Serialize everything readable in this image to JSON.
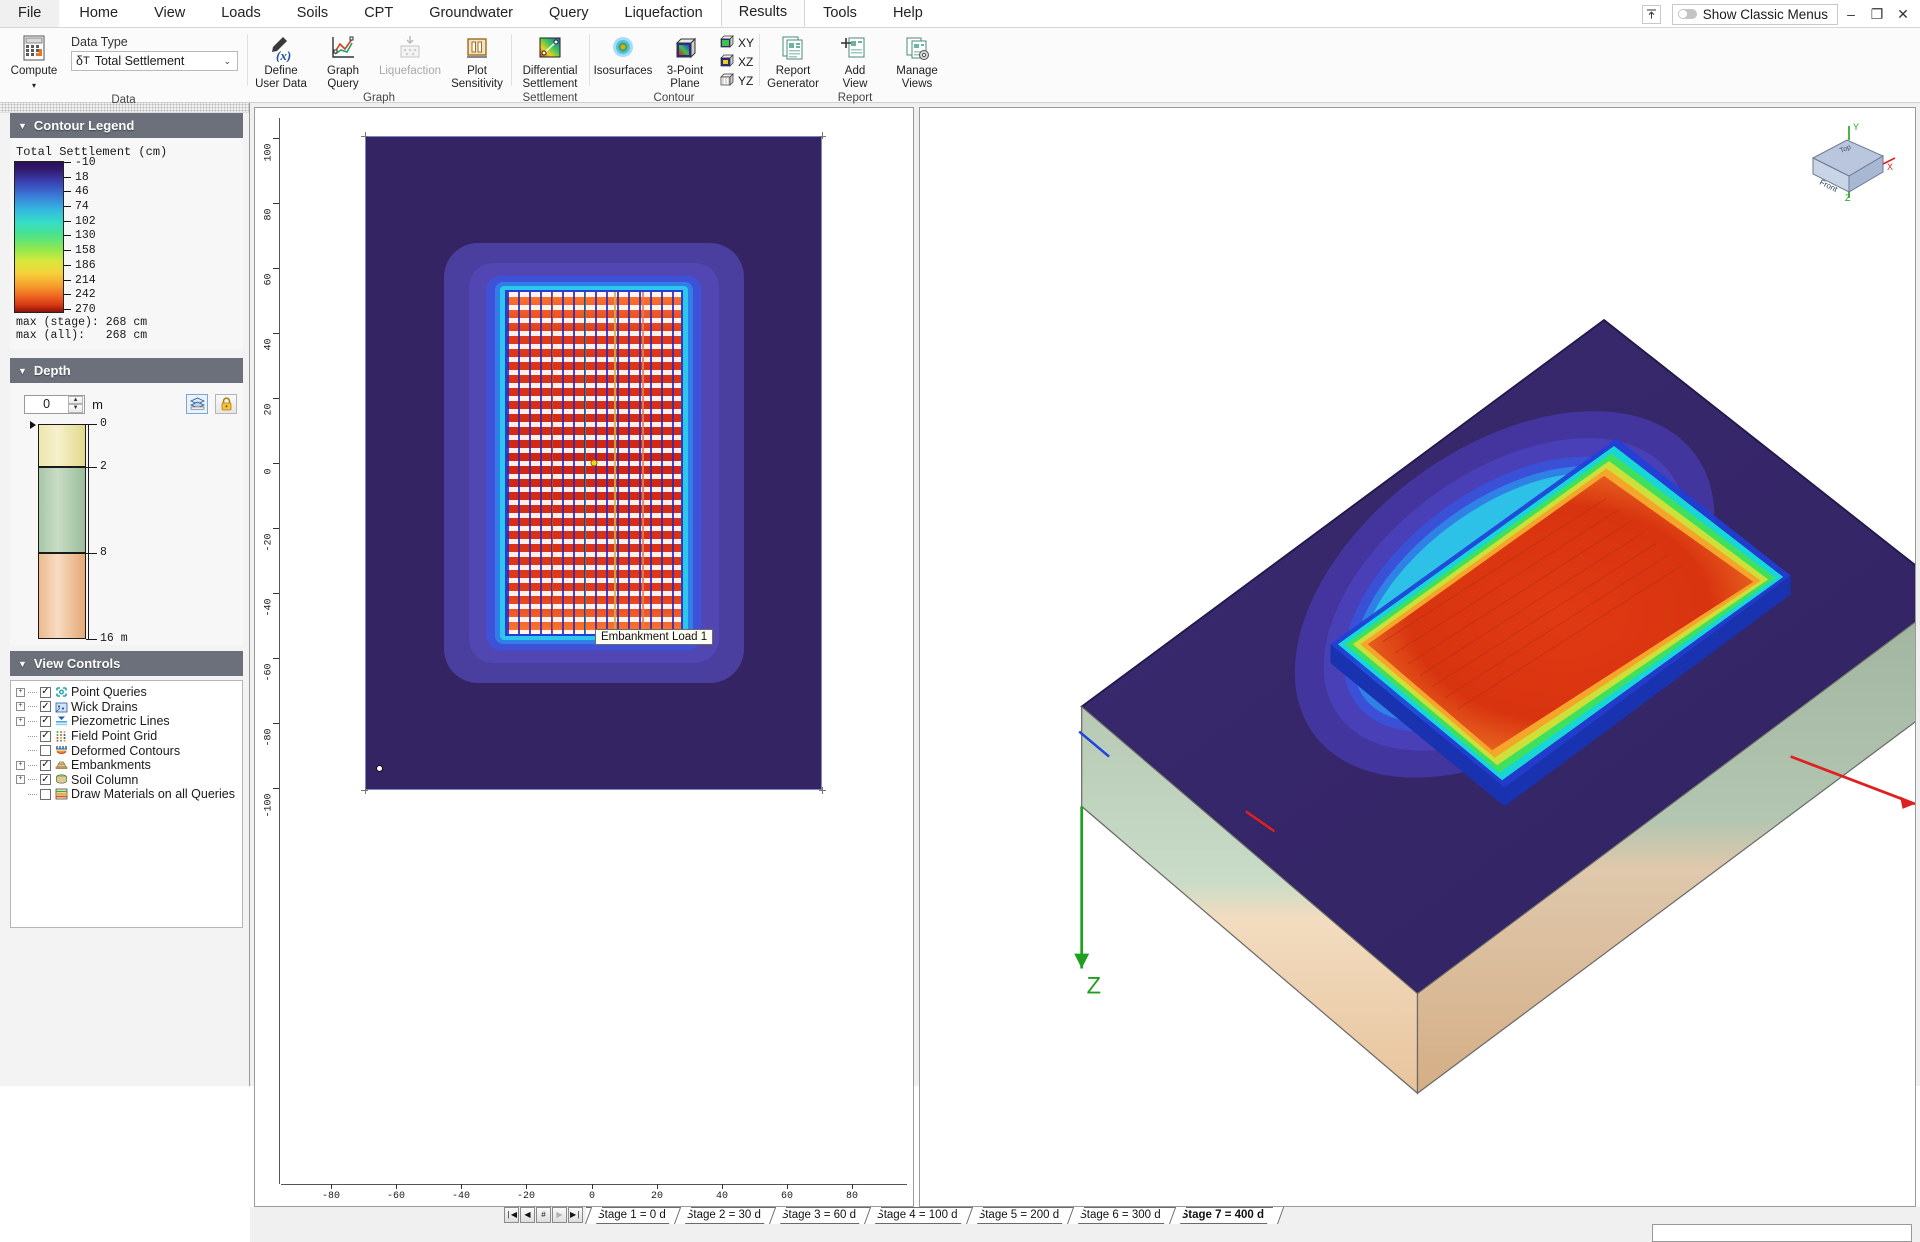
{
  "window": {
    "tabs": [
      "File",
      "Home",
      "View",
      "Loads",
      "Soils",
      "CPT",
      "Groundwater",
      "Query",
      "Liquefaction",
      "Results",
      "Tools",
      "Help"
    ],
    "active_tab": "Results",
    "classic_menus_label": "Show Classic Menus",
    "collapse_icon": "collapse-ribbon-icon",
    "minimize": "–",
    "maximize": "❐",
    "close": "✕"
  },
  "ribbon": {
    "groups": [
      {
        "label": "Data",
        "items": [
          {
            "name": "compute",
            "label": "Compute",
            "icon": "calculator-icon",
            "disabled": false,
            "dropdown": "▾"
          },
          {
            "name": "data-type",
            "label": "Data Type",
            "icon": "combo-icon",
            "disabled": false
          }
        ]
      },
      {
        "label": "Graph",
        "items": [
          {
            "name": "define-user-data",
            "label": "Define\nUser Data",
            "icon": "function-pen-icon",
            "disabled": false
          },
          {
            "name": "graph-query",
            "label": "Graph\nQuery",
            "icon": "line-graph-icon",
            "disabled": false
          },
          {
            "name": "liquefaction",
            "label": "Liquefaction",
            "icon": "liquefaction-icon",
            "disabled": true
          },
          {
            "name": "plot-sensitivity",
            "label": "Plot\nSensitivity",
            "icon": "bar-plot-icon",
            "disabled": false
          }
        ]
      },
      {
        "label": "Settlement",
        "items": [
          {
            "name": "differential-settlement",
            "label": "Differential\nSettlement",
            "icon": "gradient-line-icon",
            "disabled": false
          }
        ]
      },
      {
        "label": "Contour",
        "items": [
          {
            "name": "isosurfaces",
            "label": "Isosurfaces",
            "icon": "isosurface-icon",
            "disabled": false
          },
          {
            "name": "three-point-plane",
            "label": "3-Point\nPlane",
            "icon": "cube-plane-icon",
            "disabled": false
          },
          {
            "name": "plane-xy",
            "label": "XY",
            "icon": "cube-xy-icon",
            "disabled": false
          },
          {
            "name": "plane-xz",
            "label": "XZ",
            "icon": "cube-xz-icon",
            "disabled": false
          },
          {
            "name": "plane-yz",
            "label": "YZ",
            "icon": "cube-yz-icon",
            "disabled": false
          }
        ]
      },
      {
        "label": "Report",
        "items": [
          {
            "name": "report-generator",
            "label": "Report\nGenerator",
            "icon": "report-icon",
            "disabled": false
          },
          {
            "name": "add-view",
            "label": "Add\nView",
            "icon": "add-view-icon",
            "disabled": false
          },
          {
            "name": "manage-views",
            "label": "Manage\nViews",
            "icon": "manage-views-icon",
            "disabled": false
          }
        ]
      }
    ],
    "data_type": {
      "label": "Data Type",
      "symbol": "δ",
      "subscript": "T",
      "value": "Total Settlement",
      "chevron": "⌄"
    }
  },
  "left_panel": {
    "contour_legend": {
      "title": "Contour Legend",
      "caption": "Total Settlement (cm)",
      "ticks": [
        "-10",
        "18",
        "46",
        "74",
        "102",
        "130",
        "158",
        "186",
        "214",
        "242",
        "270"
      ],
      "max_stage": "max (stage): 268 cm",
      "max_all": "max (all):   268 cm"
    },
    "depth": {
      "title": "Depth",
      "value": "0",
      "unit": "m",
      "btn_layers_icon": "layers-icon",
      "btn_lock_icon": "lock-icon",
      "layers": [
        {
          "name": "layer-1",
          "top_label": "0",
          "bottom_label": "2",
          "color_a": "#f2edbb",
          "color_b": "#e6dd93"
        },
        {
          "name": "layer-2",
          "top_label": "2",
          "bottom_label": "8",
          "color_a": "#c3d9c2",
          "color_b": "#a7c6a6"
        },
        {
          "name": "layer-3",
          "top_label": "8",
          "bottom_label": "16 m",
          "color_a": "#f4d5b4",
          "color_b": "#e8b489"
        }
      ]
    },
    "view_controls": {
      "title": "View Controls",
      "items": [
        {
          "label": "Point Queries",
          "checked": true,
          "expandable": true,
          "icon": "point-query-icon"
        },
        {
          "label": "Wick Drains",
          "checked": true,
          "expandable": true,
          "icon": "wick-drain-icon"
        },
        {
          "label": "Piezometric Lines",
          "checked": true,
          "expandable": true,
          "icon": "piezometric-icon"
        },
        {
          "label": "Field Point Grid",
          "checked": true,
          "expandable": false,
          "icon": "point-grid-icon"
        },
        {
          "label": "Deformed Contours",
          "checked": false,
          "expandable": false,
          "icon": "deformed-contour-icon"
        },
        {
          "label": "Embankments",
          "checked": true,
          "expandable": true,
          "icon": "embankment-icon"
        },
        {
          "label": "Soil Column",
          "checked": true,
          "expandable": true,
          "icon": "soil-column-icon"
        },
        {
          "label": "Draw Materials on all Queries",
          "checked": false,
          "expandable": false,
          "icon": "materials-icon"
        }
      ]
    }
  },
  "plot_2d": {
    "tooltip": "Embankment Load 1",
    "x_ticks": [
      "-80",
      "-60",
      "-40",
      "-20",
      "0",
      "20",
      "40",
      "60",
      "80"
    ],
    "y_ticks": [
      "100",
      "80",
      "60",
      "40",
      "20",
      "0",
      "-20",
      "-40",
      "-60",
      "-80",
      "-100"
    ]
  },
  "view_3d": {
    "orientation_cube": {
      "front_label": "Front",
      "top_label": "Top",
      "axis_x": "X",
      "axis_y": "Y",
      "axis_z": "Z"
    },
    "axis_z_label": "Z"
  },
  "stage_bar": {
    "nav": [
      {
        "name": "first-stage-button",
        "glyph": "|◀",
        "dim": false
      },
      {
        "name": "previous-stage-button",
        "glyph": "◀",
        "dim": false
      },
      {
        "name": "stage-number-button",
        "glyph": "#",
        "dim": false
      },
      {
        "name": "next-stage-button",
        "glyph": "▶",
        "dim": true
      },
      {
        "name": "last-stage-button",
        "glyph": "▶|",
        "dim": false
      }
    ],
    "stages": [
      {
        "label": "Stage 1 = 0 d",
        "active": false
      },
      {
        "label": "Stage 2 = 30 d",
        "active": false
      },
      {
        "label": "Stage 3 = 60 d",
        "active": false
      },
      {
        "label": "Stage 4 = 100 d",
        "active": false
      },
      {
        "label": "Stage 5 = 200 d",
        "active": false
      },
      {
        "label": "Stage 6 = 300 d",
        "active": false
      },
      {
        "label": "Stage 7 = 400 d",
        "active": true
      }
    ]
  },
  "colors": {
    "panel_header": "#6b707a",
    "accent_blue": "#2b579a",
    "contour_background": "#352464"
  }
}
